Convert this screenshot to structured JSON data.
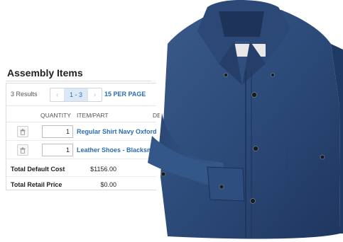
{
  "panel": {
    "title": "Assembly Items",
    "results_text": "3 Results",
    "pager": {
      "prev": "‹",
      "range": "1 - 3",
      "next": "›"
    },
    "per_page": "15 PER PAGE",
    "columns": {
      "quantity": "QUANTITY",
      "item_part": "ITEM/PART",
      "desc_truncated": "DE"
    },
    "rows": [
      {
        "quantity": "1",
        "item": "Regular Shirt Navy Oxford",
        "delete_icon": "trash-icon"
      },
      {
        "quantity": "1",
        "item": "Leather Shoes - Blacksmith",
        "delete_icon": "trash-icon"
      }
    ],
    "totals": [
      {
        "label": "Total Default Cost",
        "value": "$1156.00"
      },
      {
        "label": "Total Retail Price",
        "value": "$0.00"
      }
    ]
  },
  "photo": {
    "subject": "navy oxford button-down shirt"
  },
  "colors": {
    "link": "#2a6db5",
    "pager_active": "#dbe9f6",
    "shirt": "#2c4a78"
  }
}
